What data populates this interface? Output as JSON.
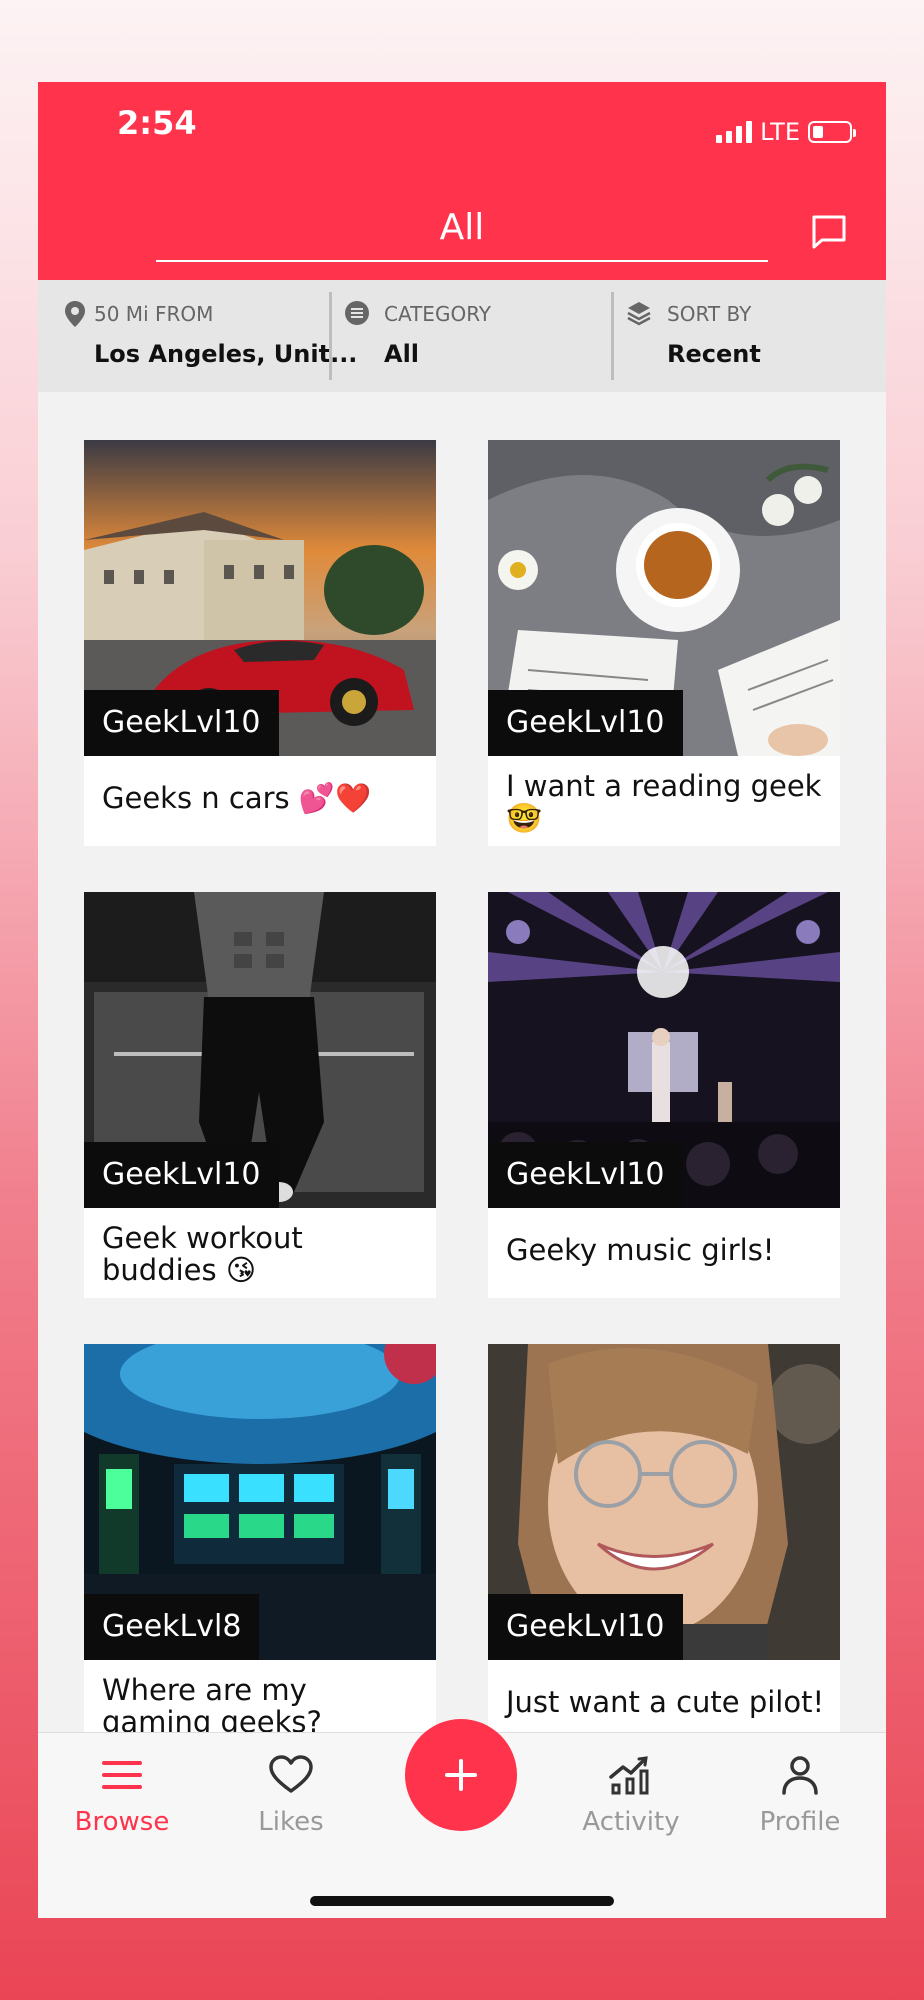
{
  "status": {
    "time": "2:54",
    "network": "LTE"
  },
  "header": {
    "tab_label": "All"
  },
  "filters": {
    "distance": {
      "label": "50 Mi FROM",
      "value": "Los Angeles, Unit..."
    },
    "category": {
      "label": "CATEGORY",
      "value": "All"
    },
    "sort": {
      "label": "SORT BY",
      "value": "Recent"
    }
  },
  "posts": [
    {
      "user": "GeekLvl10",
      "caption": "Geeks n cars 💕❤️"
    },
    {
      "user": "GeekLvl10",
      "caption": "I want a reading geek 🤓"
    },
    {
      "user": "GeekLvl10",
      "caption": "Geek workout buddies 😘"
    },
    {
      "user": "GeekLvl10",
      "caption": "Geeky music girls!"
    },
    {
      "user": "GeekLvl8",
      "caption": "Where are my gaming geeks?"
    },
    {
      "user": "GeekLvl10",
      "caption": "Just want a cute pilot!"
    }
  ],
  "nav": {
    "browse": "Browse",
    "likes": "Likes",
    "activity": "Activity",
    "profile": "Profile"
  },
  "colors": {
    "accent": "#ff344c",
    "nav_inactive": "#999999"
  }
}
